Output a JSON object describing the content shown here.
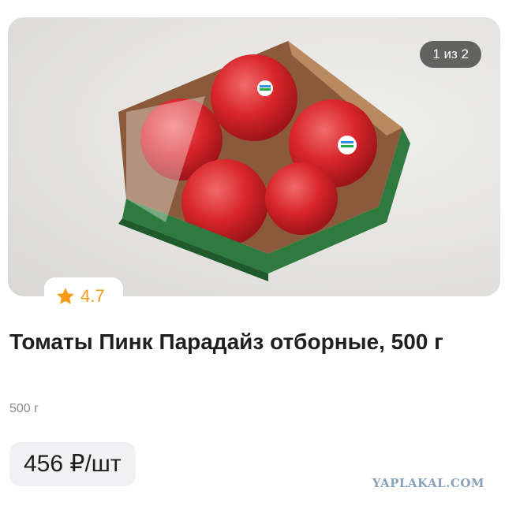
{
  "gallery": {
    "counter": "1 из 2"
  },
  "rating": {
    "value": "4.7",
    "icon": "star-icon",
    "color": "#f49b18"
  },
  "product": {
    "title": "Томаты Пинк Парадайз отборные, 500 г",
    "weight": "500 г",
    "price": "456 ₽/шт"
  },
  "watermark": "YAPLAKAL.COM"
}
